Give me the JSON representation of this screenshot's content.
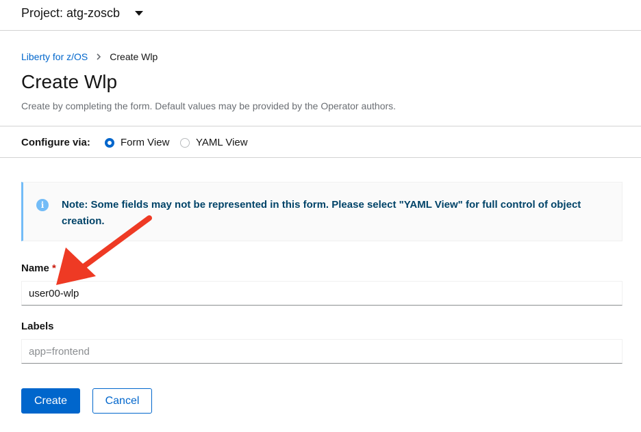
{
  "project": {
    "label": "Project: atg-zoscb"
  },
  "breadcrumb": {
    "parent": "Liberty for z/OS",
    "current": "Create Wlp"
  },
  "page": {
    "title": "Create Wlp",
    "description": "Create by completing the form. Default values may be provided by the Operator authors."
  },
  "configure": {
    "label": "Configure via:",
    "options": [
      {
        "label": "Form View",
        "checked": true
      },
      {
        "label": "YAML View",
        "checked": false
      }
    ]
  },
  "alert": {
    "text": "Note: Some fields may not be represented in this form. Please select \"YAML View\" for full control of object creation."
  },
  "form": {
    "name": {
      "label": "Name",
      "required_mark": "*",
      "value": "user00-wlp"
    },
    "labels": {
      "label": "Labels",
      "placeholder": "app=frontend",
      "value": ""
    }
  },
  "actions": {
    "create": "Create",
    "cancel": "Cancel"
  },
  "annotation": {
    "arrow_color": "#ee3a24"
  }
}
